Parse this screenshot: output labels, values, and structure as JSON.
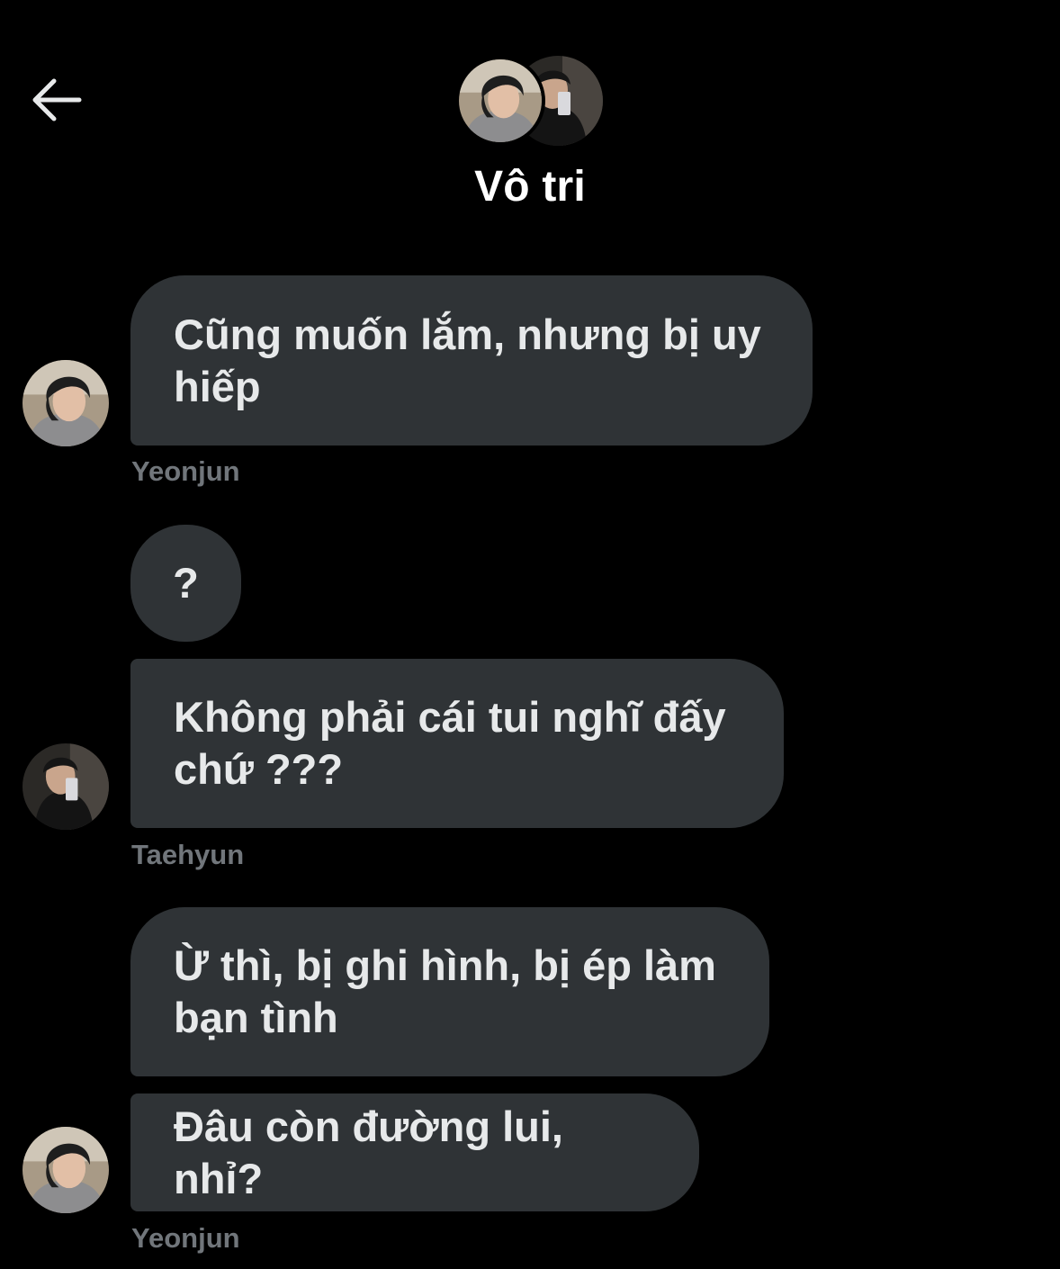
{
  "header": {
    "back_icon": "arrow-left-icon",
    "title": "Vô tri",
    "avatars": [
      "yeonjun-avatar",
      "taehyun-avatar"
    ]
  },
  "messages": [
    {
      "sender": "Yeonjun",
      "text": "Cũng muốn lắm, nhưng bị uy hiếp"
    },
    {
      "sender": "Taehyun",
      "text": "?"
    },
    {
      "sender": "Taehyun",
      "text": "Không phải cái tui nghĩ đấy chứ ???"
    },
    {
      "sender": "Yeonjun",
      "text": "Ừ thì, bị ghi hình, bị ép làm bạn tình"
    },
    {
      "sender": "Yeonjun",
      "text": "Đâu còn đường lui, nhỉ?"
    }
  ],
  "senders": {
    "yeonjun": "Yeonjun",
    "taehyun": "Taehyun"
  },
  "colors": {
    "background": "#000000",
    "bubble": "#2f3336",
    "text": "#e7e9ea",
    "secondary_text": "#71767b"
  }
}
